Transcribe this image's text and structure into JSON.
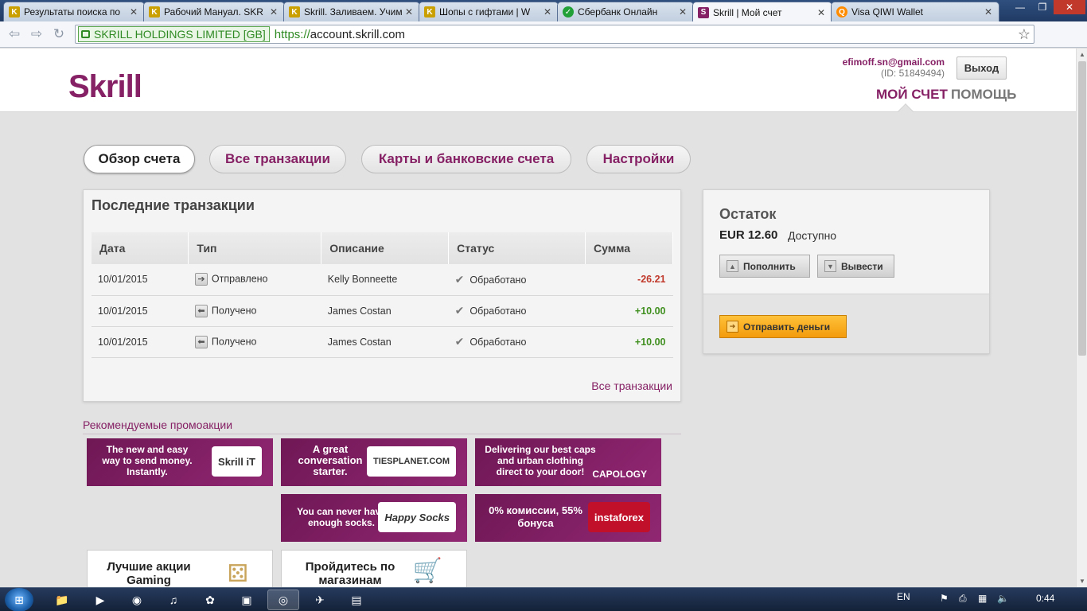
{
  "browser": {
    "tabs": [
      {
        "label": "Результаты поиска по",
        "icon": "kaspersky-icon",
        "color": "#1f1f1f"
      },
      {
        "label": "Рабочий Мануал. SKR",
        "icon": "kaspersky-icon",
        "color": "#1f1f1f"
      },
      {
        "label": "Skrill. Заливаем. Учим",
        "icon": "kaspersky-icon",
        "color": "#1f1f1f"
      },
      {
        "label": "Шопы с гифтами | W",
        "icon": "kaspersky-icon",
        "color": "#1f1f1f"
      },
      {
        "label": "Сбербанк Онлайн",
        "icon": "sberbank-icon",
        "color": "#21a038"
      },
      {
        "label": "Skrill | Мой счет",
        "icon": "skrill-icon",
        "color": "#862165",
        "active": true
      },
      {
        "label": "Visa QIWI Wallet",
        "icon": "qiwi-icon",
        "color": "#ff8c00"
      }
    ],
    "ev_label": "SKRILL HOLDINGS LIMITED [GB]",
    "url_scheme": "https://",
    "url_host": "account.skrill.com"
  },
  "header": {
    "logo": "Skrill",
    "email": "efimoff.sn@gmail.com",
    "user_id": "(ID: 51849494)",
    "logout": "Выход",
    "nav_account": "МОЙ СЧЕТ",
    "nav_help": "ПОМОЩЬ"
  },
  "tabs": [
    "Обзор счета",
    "Все транзакции",
    "Карты и банковские счета",
    "Настройки"
  ],
  "transactions": {
    "title": "Последние транзакции",
    "columns": [
      "Дата",
      "Тип",
      "Описание",
      "Статус",
      "Сумма"
    ],
    "rows": [
      {
        "date": "10/01/2015",
        "type": "Отправлено",
        "type_icon": "arrow-right-icon",
        "desc": "Kelly Bonneette",
        "status": "Обработано",
        "amount": "-26.21",
        "amount_color": "#c0392b"
      },
      {
        "date": "10/01/2015",
        "type": "Получено",
        "type_icon": "arrow-left-icon",
        "desc": "James Costan",
        "status": "Обработано",
        "amount": "+10.00",
        "amount_color": "#3f8f1f"
      },
      {
        "date": "10/01/2015",
        "type": "Получено",
        "type_icon": "arrow-left-icon",
        "desc": "James Costan",
        "status": "Обработано",
        "amount": "+10.00",
        "amount_color": "#3f8f1f"
      }
    ],
    "all_link": "Все транзакции"
  },
  "balance": {
    "title": "Остаток",
    "amount": "EUR 12.60",
    "available": "Доступно",
    "deposit": "Пополнить",
    "withdraw": "Вывести",
    "send": "Отправить деньги"
  },
  "promos": {
    "title": "Рекомендуемые промоакции",
    "items": [
      {
        "text": "The new and easy way to send money. Instantly.",
        "logo": "Skrill iT"
      },
      {
        "text": "A great conversation starter.",
        "logo": "TIESPLANET.COM"
      },
      {
        "text": "Delivering our best caps and urban clothing direct to your door!",
        "logo": "CAPOLOGY"
      },
      {
        "text": "You can never have enough socks.",
        "logo": "Happy Socks"
      },
      {
        "text": "0% комиссии, 55% бонуса",
        "logo": "instaforex"
      },
      {
        "text": "Лучшие акции Gaming",
        "logo": ""
      },
      {
        "text": "Пройдитесь по магазинам",
        "logo": ""
      }
    ]
  },
  "taskbar": {
    "lang": "EN",
    "time": "0:44"
  },
  "colors": {
    "brand": "#862165",
    "orange": "#f39b0c"
  }
}
